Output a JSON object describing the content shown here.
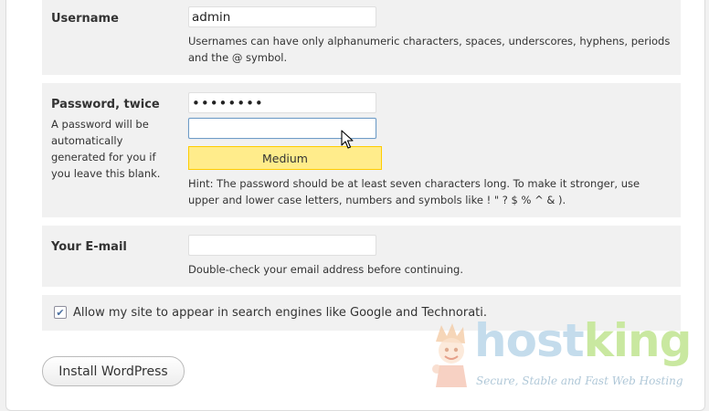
{
  "username": {
    "label": "Username",
    "value": "admin",
    "description": "Usernames can have only alphanumeric characters, spaces, underscores, hyphens, periods and the @ symbol."
  },
  "password": {
    "label": "Password, twice",
    "sublabel": "A password will be automatically generated for you if you leave this blank.",
    "value1": "••••••••",
    "value2": "",
    "strength": "Medium",
    "hint": "Hint: The password should be at least seven characters long. To make it stronger, use upper and lower case letters, numbers and symbols like ! \" ? $ % ^ & )."
  },
  "email": {
    "label": "Your E-mail",
    "value": "",
    "description": "Double-check your email address before continuing."
  },
  "privacy": {
    "checked": true,
    "label": "Allow my site to appear in search engines like Google and Technorati."
  },
  "install_button": "Install WordPress",
  "logo": {
    "word_host": "host",
    "word_king": "king",
    "tagline": "Secure, Stable and Fast Web Hosting"
  },
  "colors": {
    "row_bg": "#f1f1f1",
    "strength_bg": "#ffec8b",
    "strength_border": "#ffcc00",
    "focus_border": "#6f9cc6"
  }
}
